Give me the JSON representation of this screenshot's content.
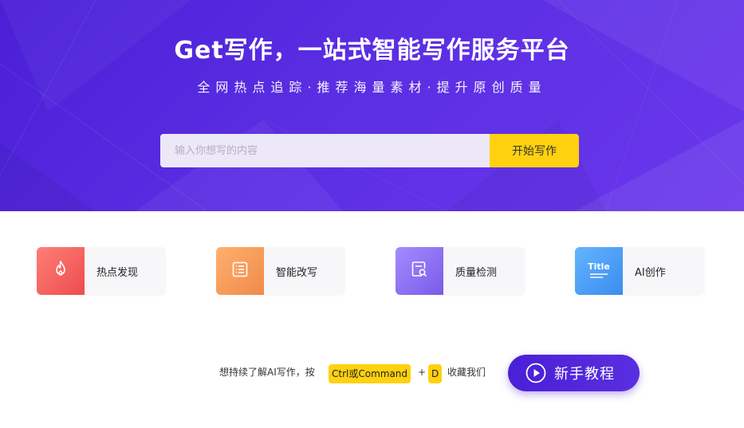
{
  "hero": {
    "title": "Get写作，一站式智能写作服务平台",
    "subtitle": "全网热点追踪·推荐海量素材·提升原创质量",
    "bg_color": "#5326df"
  },
  "search": {
    "placeholder": "输入你想写的内容",
    "button_label": "开始写作",
    "button_color": "#ffd10f"
  },
  "features": [
    {
      "label": "热点发现",
      "icon": "flame-icon",
      "color": "#f05a5a"
    },
    {
      "label": "智能改写",
      "icon": "document-list-icon",
      "color": "#f5a05e"
    },
    {
      "label": "质量检测",
      "icon": "document-search-icon",
      "color": "#8d71f0"
    },
    {
      "label": "AI创作",
      "icon": "title-doc-icon",
      "color": "#4a9af5",
      "icon_text": "Title"
    }
  ],
  "tip": {
    "text": "想持续了解AI写作，按",
    "key1": "Ctrl或Command",
    "plus": "+",
    "key2": "D",
    "suffix": "收藏我们"
  },
  "tutorial": {
    "label": "新手教程",
    "icon": "play-circle-icon"
  }
}
